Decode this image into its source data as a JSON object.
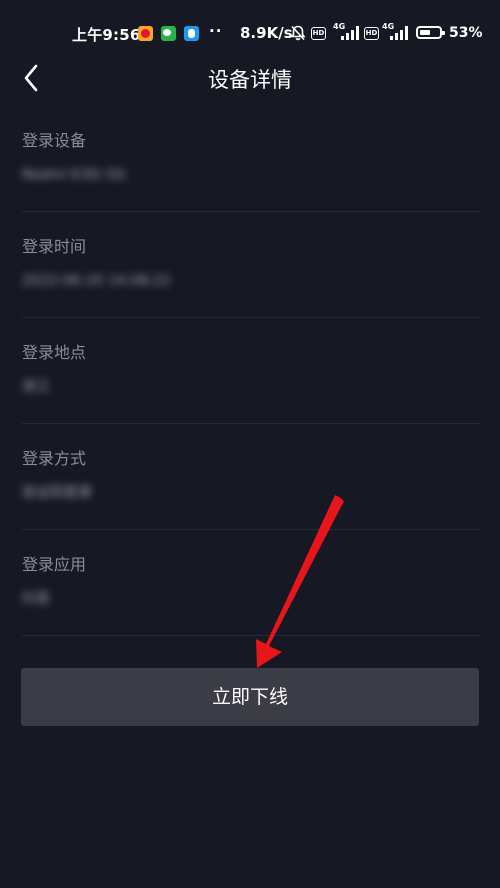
{
  "status_bar": {
    "time": "上午9:56",
    "dots": "··",
    "net_speed": "8.9K/s",
    "hd_label": "HD",
    "net_type_1": "4G",
    "net_type_2": "4G",
    "battery_level": 0.53,
    "battery_text": "53%",
    "colors": {
      "weibo": "#e6162d",
      "wechat": "#2bb24c",
      "qq": "#1e9bf0"
    }
  },
  "header": {
    "title": "设备详情",
    "back_icon": "chevron-left-icon"
  },
  "fields": [
    {
      "label": "登录设备",
      "value": "Redmi K30i 5G"
    },
    {
      "label": "登录时间",
      "value": "2022-06-20 14:08:22"
    },
    {
      "label": "登录地点",
      "value": "浙江"
    },
    {
      "label": "登录方式",
      "value": "验证码登录"
    },
    {
      "label": "登录应用",
      "value": "抖音"
    }
  ],
  "action": {
    "offline_label": "立即下线"
  },
  "theme": {
    "background": "#161823",
    "button_bg": "#3b3c45",
    "annotation_arrow": "#e8161b"
  }
}
